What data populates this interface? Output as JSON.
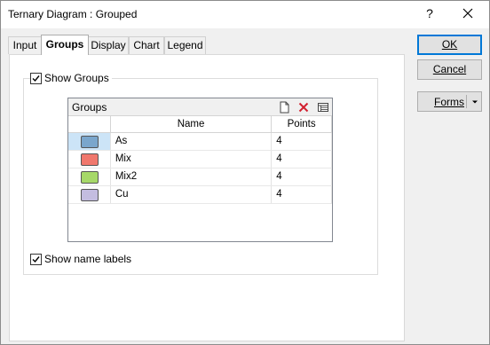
{
  "window": {
    "title": "Ternary Diagram : Grouped",
    "help_glyph": "?"
  },
  "tabs": [
    {
      "label": "Input",
      "active": false
    },
    {
      "label": "Groups",
      "active": true
    },
    {
      "label": "Display",
      "active": false
    },
    {
      "label": "Chart",
      "active": false
    },
    {
      "label": "Legend",
      "active": false
    }
  ],
  "show_groups": {
    "label": "Show Groups",
    "checked": true
  },
  "groups_grid": {
    "caption": "Groups",
    "columns": [
      "",
      "Name",
      "Points"
    ],
    "rows": [
      {
        "color": "#7aa6cc",
        "name": "As",
        "points": "4",
        "selected": true
      },
      {
        "color": "#f0776c",
        "name": "Mix",
        "points": "4",
        "selected": false
      },
      {
        "color": "#a6d868",
        "name": "Mix2",
        "points": "4",
        "selected": false
      },
      {
        "color": "#c4bde0",
        "name": "Cu",
        "points": "4",
        "selected": false
      }
    ]
  },
  "show_name_labels": {
    "label": "Show name labels",
    "checked": true
  },
  "buttons": {
    "ok": "OK",
    "cancel": "Cancel",
    "forms": "Forms"
  }
}
